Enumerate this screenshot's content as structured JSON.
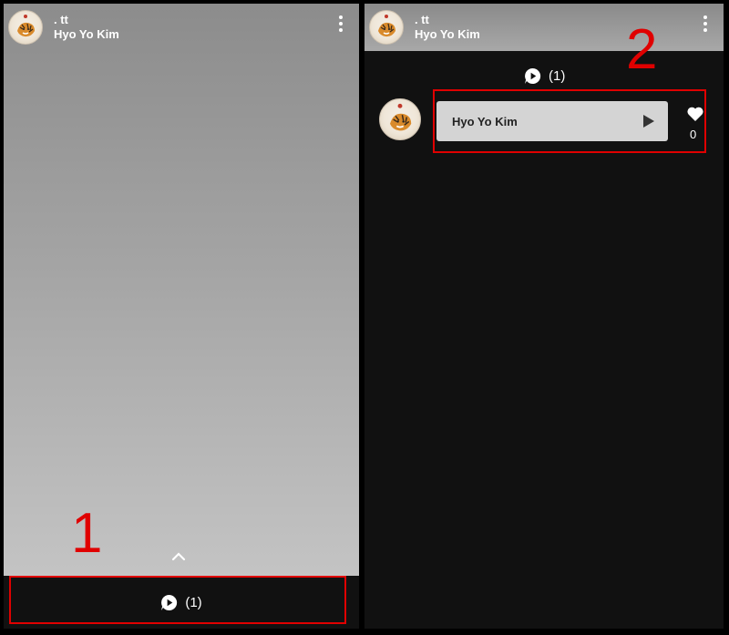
{
  "left": {
    "header": {
      "title": ". tt",
      "author": "Hyo Yo Kim"
    },
    "comment_bar": {
      "count": "(1)"
    },
    "step": "1"
  },
  "right": {
    "header": {
      "title": ". tt",
      "author": "Hyo Yo Kim"
    },
    "comments_header": {
      "count": "(1)"
    },
    "comment": {
      "author": "Hyo Yo Kim",
      "likes": "0"
    },
    "step": "2"
  },
  "icons": {
    "more": "more-vertical-icon",
    "bubble": "chat-bubble-play-icon",
    "chevron": "chevron-up-icon",
    "play": "play-icon",
    "heart": "heart-icon",
    "avatar": "tiger-avatar"
  },
  "colors": {
    "highlight": "#e00000",
    "dark_panel": "#111111"
  }
}
